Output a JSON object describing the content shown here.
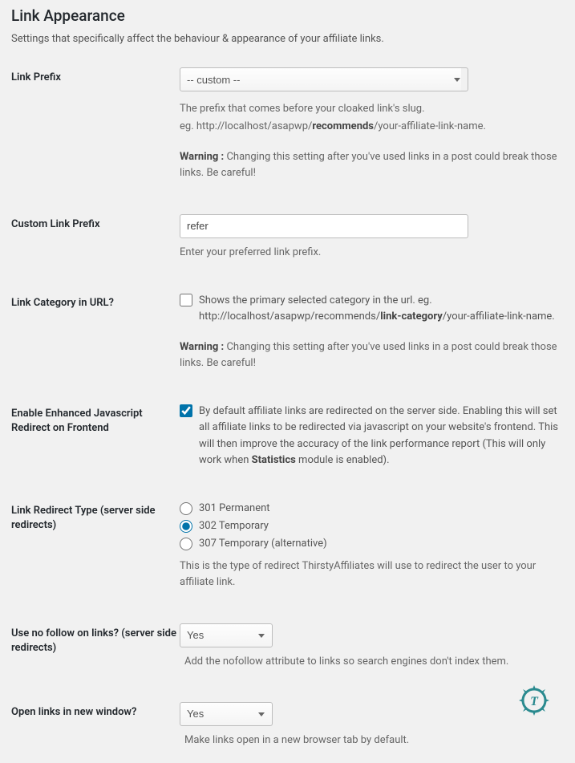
{
  "page": {
    "title": "Link Appearance",
    "subtitle": "Settings that specifically affect the behaviour & appearance of your affiliate links."
  },
  "linkPrefix": {
    "label": "Link Prefix",
    "selected": "-- custom --",
    "desc1": "The prefix that comes before your cloaked link's slug.",
    "desc2_pre": "eg. http://localhost/asapwp/",
    "desc2_bold": "recommends",
    "desc2_post": "/your-affiliate-link-name.",
    "warning_label": "Warning :",
    "warning_text": " Changing this setting after you've used links in a post could break those links. Be careful!"
  },
  "customPrefix": {
    "label": "Custom Link Prefix",
    "value": "refer",
    "desc": "Enter your preferred link prefix."
  },
  "categoryInUrl": {
    "label": "Link Category in URL?",
    "checked": false,
    "text_pre": "Shows the primary selected category in the url. eg. http://localhost/asapwp/recommends/",
    "text_bold": "link-category",
    "text_post": "/your-affiliate-link-name.",
    "warning_label": "Warning :",
    "warning_text": " Changing this setting after you've used links in a post could break those links. Be careful!"
  },
  "enhancedJs": {
    "label": "Enable Enhanced Javascript Redirect on Frontend",
    "checked": true,
    "text_pre": "By default affiliate links are redirected on the server side. Enabling this will set all affiliate links to be redirected via javascript on your website's frontend. This will then improve the accuracy of the link performance report (This will only work when ",
    "text_bold": "Statistics",
    "text_post": " module is enabled)."
  },
  "redirectType": {
    "label": "Link Redirect Type (server side redirects)",
    "opt1": "301 Permanent",
    "opt2": "302 Temporary",
    "opt3": "307 Temporary (alternative)",
    "selected": "302",
    "desc": "This is the type of redirect ThirstyAffiliates will use to redirect the user to your affiliate link."
  },
  "noFollow": {
    "label": "Use no follow on links? (server side redirects)",
    "selected": "Yes",
    "desc": "Add the nofollow attribute to links so search engines don't index them."
  },
  "newWindow": {
    "label": "Open links in new window?",
    "selected": "Yes",
    "desc": "Make links open in a new browser tab by default."
  }
}
